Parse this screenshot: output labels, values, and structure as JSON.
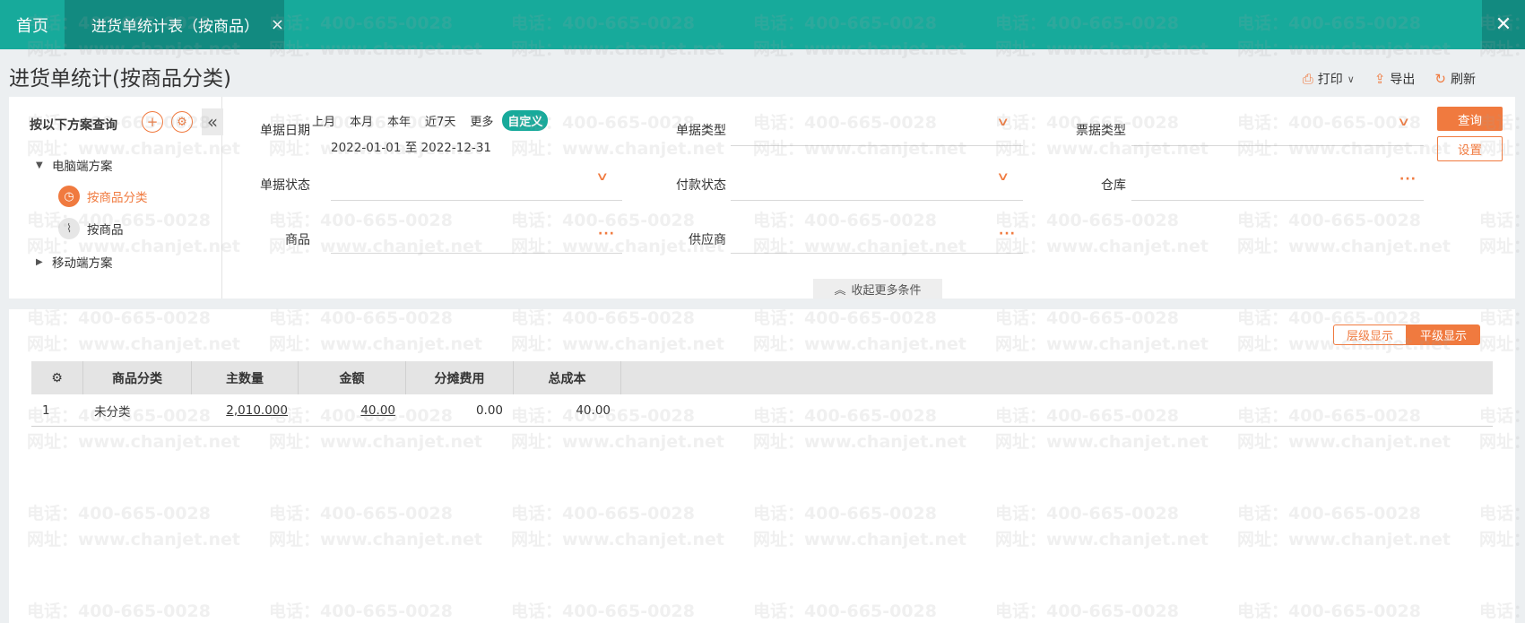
{
  "tabs": {
    "home": "首页",
    "active": "进货单统计表（按商品）",
    "tab_close": "×",
    "close_all": "✕"
  },
  "page": {
    "title": "进货单统计(按商品分类)"
  },
  "toolbar": {
    "print": "打印",
    "export": "导出",
    "refresh": "刷新"
  },
  "scheme": {
    "header": "按以下方案查询",
    "add": "+",
    "settings": "⚙",
    "collapse": "«",
    "groups": [
      {
        "label": "电脑端方案",
        "items": [
          "按商品分类",
          "按商品"
        ]
      },
      {
        "label": "移动端方案"
      }
    ],
    "active_item": "按商品分类"
  },
  "filters": {
    "doc_date": {
      "label": "单据日期",
      "chips": [
        "上月",
        "本月",
        "本年",
        "近7天",
        "更多",
        "自定义"
      ],
      "selected": "自定义",
      "range": "2022-01-01 至 2022-12-31"
    },
    "doc_type": {
      "label": "单据类型",
      "value": ""
    },
    "invoice_type": {
      "label": "票据类型",
      "value": ""
    },
    "doc_status": {
      "label": "单据状态",
      "value": ""
    },
    "payment_status": {
      "label": "付款状态",
      "value": ""
    },
    "warehouse": {
      "label": "仓库",
      "value": ""
    },
    "product": {
      "label": "商品",
      "value": ""
    },
    "supplier": {
      "label": "供应商",
      "value": ""
    },
    "query_btn": "查询",
    "settings_btn": "设置",
    "collapse_more": "收起更多条件"
  },
  "view_toggle": {
    "hierarchical": "层级显示",
    "flat": "平级显示",
    "selected": "平级显示"
  },
  "table": {
    "columns": [
      "商品分类",
      "主数量",
      "金额",
      "分摊费用",
      "总成本"
    ],
    "rows": [
      {
        "index": "1",
        "category": "未分类",
        "qty": "2,010.000",
        "amount": "40.00",
        "fee": "0.00",
        "cost": "40.00"
      }
    ]
  },
  "watermark": {
    "phone": "电话：400-665-0028",
    "site": "网址：www.chanjet.net"
  },
  "colors": {
    "teal": "#17aa9b",
    "teal_dark": "#128a80",
    "orange": "#f07a3f"
  }
}
